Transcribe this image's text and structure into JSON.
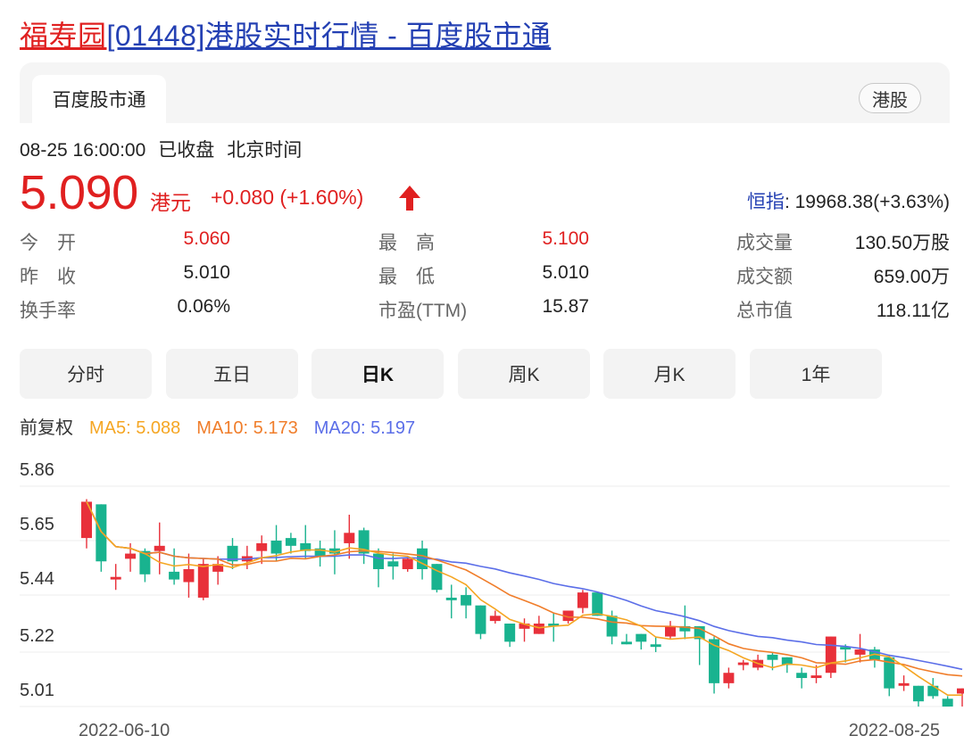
{
  "title": {
    "highlight": "福寿园",
    "rest": "[01448]港股实时行情 - 百度股市通"
  },
  "card": {
    "tab_label": "百度股市通",
    "badge_label": "港股"
  },
  "status": {
    "datetime": "08-25 16:00:00",
    "state": "已收盘",
    "timezone": "北京时间"
  },
  "quote": {
    "price": "5.090",
    "currency": "港元",
    "change": "+0.080 (+1.60%)",
    "direction_icon": "arrow-up-icon",
    "index_label": "恒指",
    "index_value": ": 19968.38(+3.63%)"
  },
  "stats": [
    [
      {
        "label": "今　开",
        "value": "5.060",
        "red": true
      },
      {
        "label": "最　高",
        "value": "5.100",
        "red": true
      },
      {
        "label": "成交量",
        "value": "130.50万股",
        "red": false
      }
    ],
    [
      {
        "label": "昨　收",
        "value": "5.010",
        "red": false
      },
      {
        "label": "最　低",
        "value": "5.010",
        "red": false
      },
      {
        "label": "成交额",
        "value": "659.00万",
        "red": false
      }
    ],
    [
      {
        "label": "换手率",
        "value": "0.06%",
        "red": false
      },
      {
        "label": "市盈(TTM)",
        "value": "15.87",
        "red": false
      },
      {
        "label": "总市值",
        "value": "118.11亿",
        "red": false
      }
    ]
  ],
  "tabs": [
    "分时",
    "五日",
    "日K",
    "周K",
    "月K",
    "1年"
  ],
  "active_tab": "日K",
  "legend": {
    "adjust": "前复权",
    "ma5": "MA5: 5.088",
    "ma10": "MA10: 5.173",
    "ma20": "MA20: 5.197"
  },
  "colors": {
    "up": "#e8303a",
    "down": "#19b38f",
    "ma5": "#f5a623",
    "ma10": "#f07d2a",
    "ma20": "#5b6ee8",
    "title_link": "#2440b3"
  },
  "chart_data": {
    "type": "candlestick",
    "y_ticks": [
      "5.86",
      "5.65",
      "5.44",
      "5.22",
      "5.01"
    ],
    "ylim": [
      5.01,
      5.86
    ],
    "x_labels": [
      "2022-06-10",
      "2022-08-25"
    ],
    "candles": [
      {
        "o": 5.66,
        "c": 5.8,
        "h": 5.81,
        "l": 5.62
      },
      {
        "o": 5.79,
        "c": 5.57,
        "h": 5.79,
        "l": 5.53
      },
      {
        "o": 5.5,
        "c": 5.51,
        "h": 5.56,
        "l": 5.46
      },
      {
        "o": 5.58,
        "c": 5.6,
        "h": 5.64,
        "l": 5.53
      },
      {
        "o": 5.61,
        "c": 5.52,
        "h": 5.62,
        "l": 5.49
      },
      {
        "o": 5.61,
        "c": 5.63,
        "h": 5.72,
        "l": 5.52
      },
      {
        "o": 5.53,
        "c": 5.5,
        "h": 5.62,
        "l": 5.48
      },
      {
        "o": 5.49,
        "c": 5.54,
        "h": 5.6,
        "l": 5.43
      },
      {
        "o": 5.43,
        "c": 5.56,
        "h": 5.58,
        "l": 5.42
      },
      {
        "o": 5.53,
        "c": 5.56,
        "h": 5.59,
        "l": 5.48
      },
      {
        "o": 5.63,
        "c": 5.57,
        "h": 5.66,
        "l": 5.54
      },
      {
        "o": 5.57,
        "c": 5.59,
        "h": 5.63,
        "l": 5.54
      },
      {
        "o": 5.61,
        "c": 5.64,
        "h": 5.67,
        "l": 5.56
      },
      {
        "o": 5.65,
        "c": 5.6,
        "h": 5.71,
        "l": 5.57
      },
      {
        "o": 5.66,
        "c": 5.63,
        "h": 5.68,
        "l": 5.6
      },
      {
        "o": 5.64,
        "c": 5.61,
        "h": 5.71,
        "l": 5.58
      },
      {
        "o": 5.62,
        "c": 5.59,
        "h": 5.65,
        "l": 5.55
      },
      {
        "o": 5.62,
        "c": 5.6,
        "h": 5.69,
        "l": 5.52
      },
      {
        "o": 5.64,
        "c": 5.68,
        "h": 5.75,
        "l": 5.58
      },
      {
        "o": 5.69,
        "c": 5.6,
        "h": 5.7,
        "l": 5.56
      },
      {
        "o": 5.6,
        "c": 5.54,
        "h": 5.62,
        "l": 5.47
      },
      {
        "o": 5.57,
        "c": 5.55,
        "h": 5.6,
        "l": 5.5
      },
      {
        "o": 5.54,
        "c": 5.58,
        "h": 5.59,
        "l": 5.53
      },
      {
        "o": 5.62,
        "c": 5.54,
        "h": 5.65,
        "l": 5.5
      },
      {
        "o": 5.56,
        "c": 5.46,
        "h": 5.56,
        "l": 5.45
      },
      {
        "o": 5.43,
        "c": 5.42,
        "h": 5.48,
        "l": 5.35
      },
      {
        "o": 5.44,
        "c": 5.4,
        "h": 5.47,
        "l": 5.35
      },
      {
        "o": 5.4,
        "c": 5.29,
        "h": 5.4,
        "l": 5.27
      },
      {
        "o": 5.34,
        "c": 5.36,
        "h": 5.38,
        "l": 5.33
      },
      {
        "o": 5.33,
        "c": 5.26,
        "h": 5.33,
        "l": 5.24
      },
      {
        "o": 5.31,
        "c": 5.33,
        "h": 5.35,
        "l": 5.26
      },
      {
        "o": 5.29,
        "c": 5.33,
        "h": 5.36,
        "l": 5.29
      },
      {
        "o": 5.33,
        "c": 5.32,
        "h": 5.37,
        "l": 5.26
      },
      {
        "o": 5.34,
        "c": 5.38,
        "h": 5.38,
        "l": 5.33
      },
      {
        "o": 5.39,
        "c": 5.45,
        "h": 5.46,
        "l": 5.37
      },
      {
        "o": 5.45,
        "c": 5.36,
        "h": 5.45,
        "l": 5.36
      },
      {
        "o": 5.36,
        "c": 5.28,
        "h": 5.38,
        "l": 5.25
      },
      {
        "o": 5.26,
        "c": 5.25,
        "h": 5.29,
        "l": 5.25
      },
      {
        "o": 5.29,
        "c": 5.26,
        "h": 5.29,
        "l": 5.23
      },
      {
        "o": 5.25,
        "c": 5.24,
        "h": 5.28,
        "l": 5.22
      },
      {
        "o": 5.28,
        "c": 5.32,
        "h": 5.34,
        "l": 5.27
      },
      {
        "o": 5.32,
        "c": 5.3,
        "h": 5.4,
        "l": 5.27
      },
      {
        "o": 5.32,
        "c": 5.27,
        "h": 5.32,
        "l": 5.17
      },
      {
        "o": 5.27,
        "c": 5.1,
        "h": 5.28,
        "l": 5.06
      },
      {
        "o": 5.1,
        "c": 5.14,
        "h": 5.16,
        "l": 5.08
      },
      {
        "o": 5.17,
        "c": 5.18,
        "h": 5.19,
        "l": 5.15
      },
      {
        "o": 5.16,
        "c": 5.19,
        "h": 5.21,
        "l": 5.15
      },
      {
        "o": 5.21,
        "c": 5.19,
        "h": 5.22,
        "l": 5.15
      },
      {
        "o": 5.2,
        "c": 5.17,
        "h": 5.2,
        "l": 5.14
      },
      {
        "o": 5.14,
        "c": 5.12,
        "h": 5.16,
        "l": 5.08
      },
      {
        "o": 5.12,
        "c": 5.13,
        "h": 5.17,
        "l": 5.1
      },
      {
        "o": 5.14,
        "c": 5.28,
        "h": 5.28,
        "l": 5.12
      },
      {
        "o": 5.24,
        "c": 5.23,
        "h": 5.25,
        "l": 5.18
      },
      {
        "o": 5.21,
        "c": 5.23,
        "h": 5.29,
        "l": 5.18
      },
      {
        "o": 5.23,
        "c": 5.19,
        "h": 5.24,
        "l": 5.16
      },
      {
        "o": 5.2,
        "c": 5.08,
        "h": 5.21,
        "l": 5.05
      },
      {
        "o": 5.09,
        "c": 5.1,
        "h": 5.13,
        "l": 5.07
      },
      {
        "o": 5.09,
        "c": 5.03,
        "h": 5.09,
        "l": 5.01
      },
      {
        "o": 5.09,
        "c": 5.05,
        "h": 5.12,
        "l": 5.04
      },
      {
        "o": 5.04,
        "c": 5.01,
        "h": 5.05,
        "l": 5.01
      },
      {
        "o": 5.06,
        "c": 5.08,
        "h": 5.08,
        "l": 5.01
      }
    ]
  }
}
